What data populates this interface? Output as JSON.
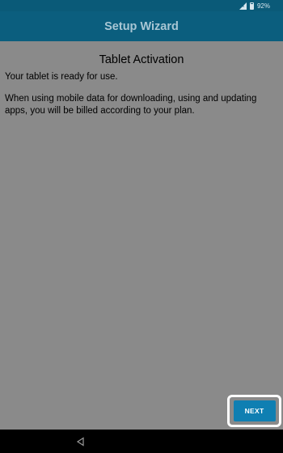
{
  "status_bar": {
    "battery_text": "92%",
    "icons": [
      "signal-icon",
      "battery-icon"
    ]
  },
  "app_bar": {
    "title": "Setup Wizard"
  },
  "main": {
    "page_title": "Tablet Activation",
    "paragraph_1": "Your tablet is ready for use.",
    "paragraph_2": "When using mobile data for downloading, using and updating apps, you will be billed according to your plan."
  },
  "footer": {
    "next_label": "NEXT"
  },
  "nav_bar": {
    "icons": [
      "back-icon"
    ]
  },
  "colors": {
    "app_bar": "#0b5e7e",
    "background": "#8a8a8a",
    "button": "#0f7fb2"
  }
}
